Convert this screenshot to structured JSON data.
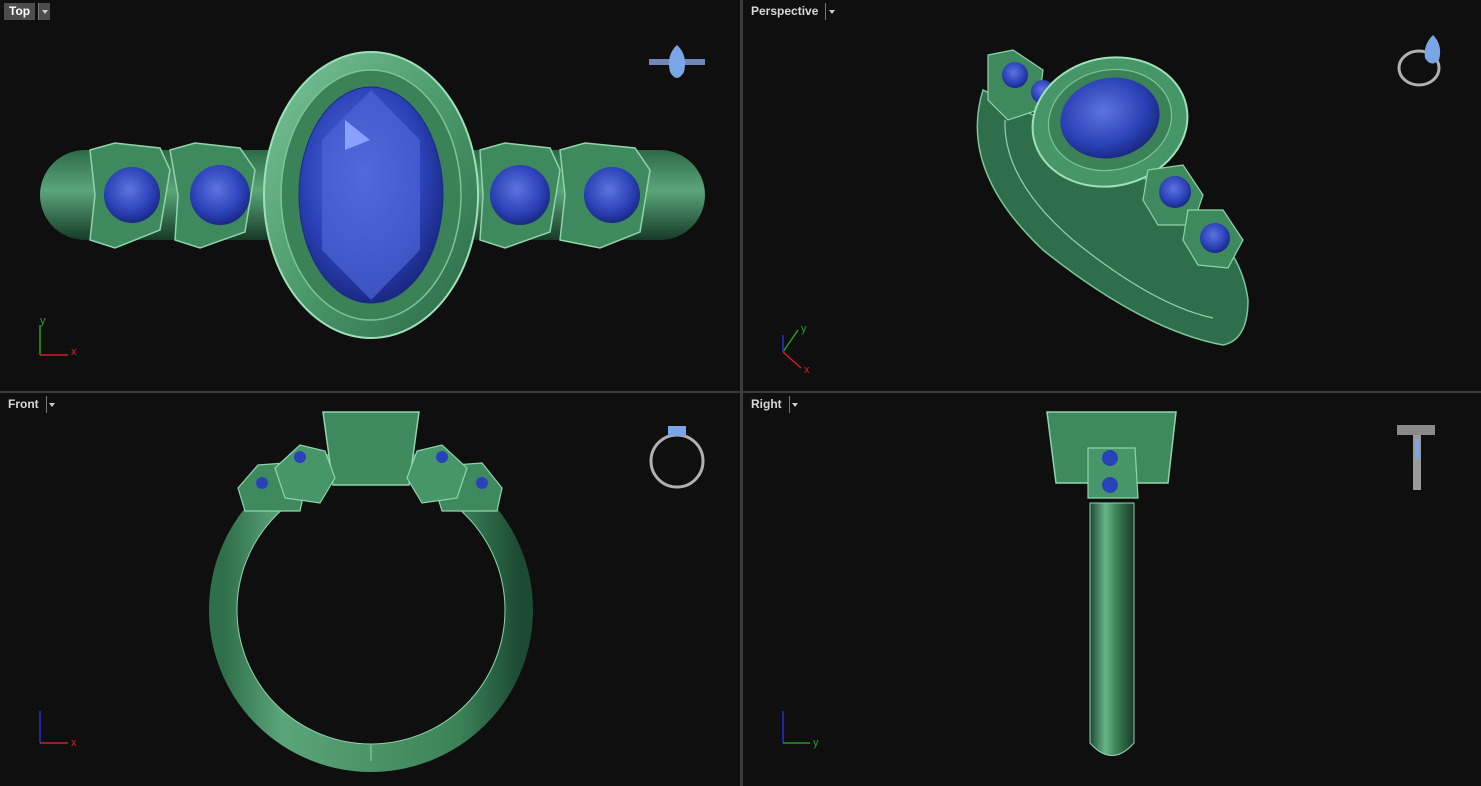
{
  "viewports": {
    "top": {
      "title": "Top",
      "active": true
    },
    "perspective": {
      "title": "Perspective",
      "active": false
    },
    "front": {
      "title": "Front",
      "active": false
    },
    "right": {
      "title": "Right",
      "active": false
    }
  },
  "axes": {
    "top": {
      "vertical": "y",
      "horizontal": "x"
    },
    "perspective": {
      "vertical": "y",
      "horizontal": "x"
    },
    "front": {
      "horizontal": "x"
    },
    "right": {
      "horizontal": "y"
    }
  },
  "colors": {
    "metal": "#3f8a5f",
    "metal_light": "#7cc49a",
    "metal_dark": "#1d4a33",
    "gem": "#2a42b8",
    "gem_light": "#6f86e8",
    "gem_dark": "#142070",
    "background": "#0f0f0f",
    "axis_x": "#d02020",
    "axis_y": "#20a020",
    "axis_z": "#2030d0",
    "title_active_bg": "#4d4d4d"
  },
  "icons": [
    "ring-preview-icon",
    "viewport-dropdown-icon"
  ]
}
